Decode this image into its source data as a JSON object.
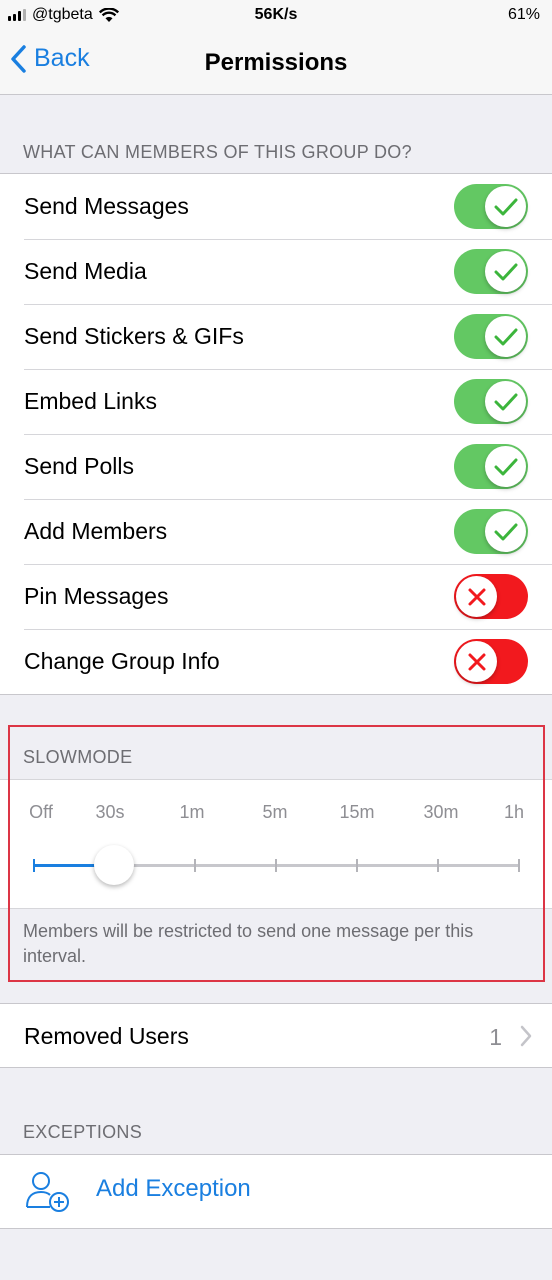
{
  "status_bar": {
    "carrier": "@tgbeta",
    "speed": "56K/s",
    "battery": "61%"
  },
  "nav": {
    "back_label": "Back",
    "title": "Permissions"
  },
  "permissions": {
    "header": "WHAT CAN MEMBERS OF THIS GROUP DO?",
    "items": [
      {
        "label": "Send Messages",
        "enabled": true
      },
      {
        "label": "Send Media",
        "enabled": true
      },
      {
        "label": "Send Stickers & GIFs",
        "enabled": true
      },
      {
        "label": "Embed Links",
        "enabled": true
      },
      {
        "label": "Send Polls",
        "enabled": true
      },
      {
        "label": "Add Members",
        "enabled": true
      },
      {
        "label": "Pin Messages",
        "enabled": false
      },
      {
        "label": "Change Group Info",
        "enabled": false
      }
    ]
  },
  "slowmode": {
    "header": "SLOWMODE",
    "options": [
      "Off",
      "30s",
      "1m",
      "5m",
      "15m",
      "30m",
      "1h"
    ],
    "selected": "30s",
    "footer": "Members will be restricted to send one message per this interval."
  },
  "removed_users": {
    "label": "Removed Users",
    "count": "1"
  },
  "exceptions": {
    "header": "EXCEPTIONS",
    "add_label": "Add Exception"
  },
  "colors": {
    "accent": "#1a7fe0",
    "toggle_on": "#63c863",
    "toggle_off": "#f2191e",
    "highlight": "#dc3545"
  }
}
